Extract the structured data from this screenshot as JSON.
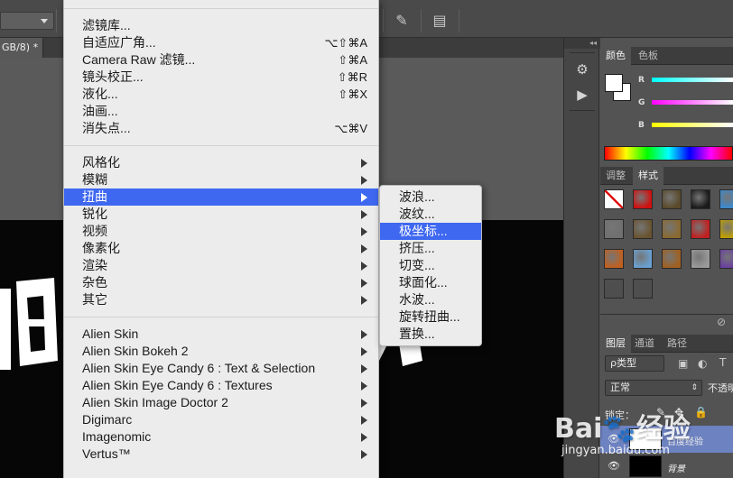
{
  "document": {
    "tab_label": "GB/8) *"
  },
  "canvas": {
    "background": "#060606",
    "art_fill": "#ffffff"
  },
  "main_menu": {
    "highlighted_index": 9,
    "groups": [
      [
        {
          "label": "滤镜库...",
          "shortcut": "",
          "submenu": false
        },
        {
          "label": "自适应广角...",
          "shortcut": "⌥⇧⌘A",
          "submenu": false
        },
        {
          "label": "Camera Raw 滤镜...",
          "shortcut": "⇧⌘A",
          "submenu": false
        },
        {
          "label": "镜头校正...",
          "shortcut": "⇧⌘R",
          "submenu": false
        },
        {
          "label": "液化...",
          "shortcut": "⇧⌘X",
          "submenu": false
        },
        {
          "label": "油画...",
          "shortcut": "",
          "submenu": false
        },
        {
          "label": "消失点...",
          "shortcut": "⌥⌘V",
          "submenu": false
        }
      ],
      [
        {
          "label": "风格化",
          "shortcut": "",
          "submenu": true
        },
        {
          "label": "模糊",
          "shortcut": "",
          "submenu": true
        },
        {
          "label": "扭曲",
          "shortcut": "",
          "submenu": true
        },
        {
          "label": "锐化",
          "shortcut": "",
          "submenu": true
        },
        {
          "label": "视频",
          "shortcut": "",
          "submenu": true
        },
        {
          "label": "像素化",
          "shortcut": "",
          "submenu": true
        },
        {
          "label": "渲染",
          "shortcut": "",
          "submenu": true
        },
        {
          "label": "杂色",
          "shortcut": "",
          "submenu": true
        },
        {
          "label": "其它",
          "shortcut": "",
          "submenu": true
        }
      ],
      [
        {
          "label": "Alien Skin",
          "shortcut": "",
          "submenu": true
        },
        {
          "label": "Alien Skin Bokeh 2",
          "shortcut": "",
          "submenu": true
        },
        {
          "label": "Alien Skin Eye Candy 6 : Text & Selection",
          "shortcut": "",
          "submenu": true
        },
        {
          "label": "Alien Skin Eye Candy 6 : Textures",
          "shortcut": "",
          "submenu": true
        },
        {
          "label": "Alien Skin Image Doctor 2",
          "shortcut": "",
          "submenu": true
        },
        {
          "label": "Digimarc",
          "shortcut": "",
          "submenu": true
        },
        {
          "label": "Imagenomic",
          "shortcut": "",
          "submenu": true
        },
        {
          "label": "Vertus™",
          "shortcut": "",
          "submenu": true
        }
      ]
    ]
  },
  "submenu": {
    "highlighted_index": 2,
    "items": [
      "波浪...",
      "波纹...",
      "极坐标...",
      "挤压...",
      "切变...",
      "球面化...",
      "水波...",
      "旋转扭曲...",
      "置换..."
    ]
  },
  "color_panel": {
    "tabs": [
      "颜色",
      "色板"
    ],
    "channels": [
      {
        "label": "R",
        "gradient": "linear-gradient(to right,#00ffff,#ffffff)"
      },
      {
        "label": "G",
        "gradient": "linear-gradient(to right,#ff00ff,#ffffff)"
      },
      {
        "label": "B",
        "gradient": "linear-gradient(to right,#ffff00,#ffffff)"
      }
    ]
  },
  "styles_panel": {
    "tabs": [
      "调整",
      "样式"
    ],
    "swatches": [
      "none-red",
      "#d01010",
      "#5a4a2a",
      "#1a1a1a",
      "#3a8ad0",
      "#707070",
      "#6a5430",
      "#8a6a30",
      "#c02020",
      "#c0a000",
      "#c06020",
      "#6aa0d0",
      "#a06020",
      "#9a9a9a",
      "#6a40a0",
      "empty",
      "empty"
    ]
  },
  "layers_panel": {
    "tabs": [
      "图层",
      "通道",
      "路径"
    ],
    "filter_label": "ρ类型",
    "blend_mode": "正常",
    "opacity_label": "不透明",
    "lock_label": "锁定：",
    "layers": [
      {
        "name": "百度经验",
        "selected": true
      },
      {
        "name": "背景",
        "selected": false
      }
    ]
  },
  "watermark": {
    "brand": "Bai🐾经验",
    "url": "jingyan.baidu.com"
  }
}
